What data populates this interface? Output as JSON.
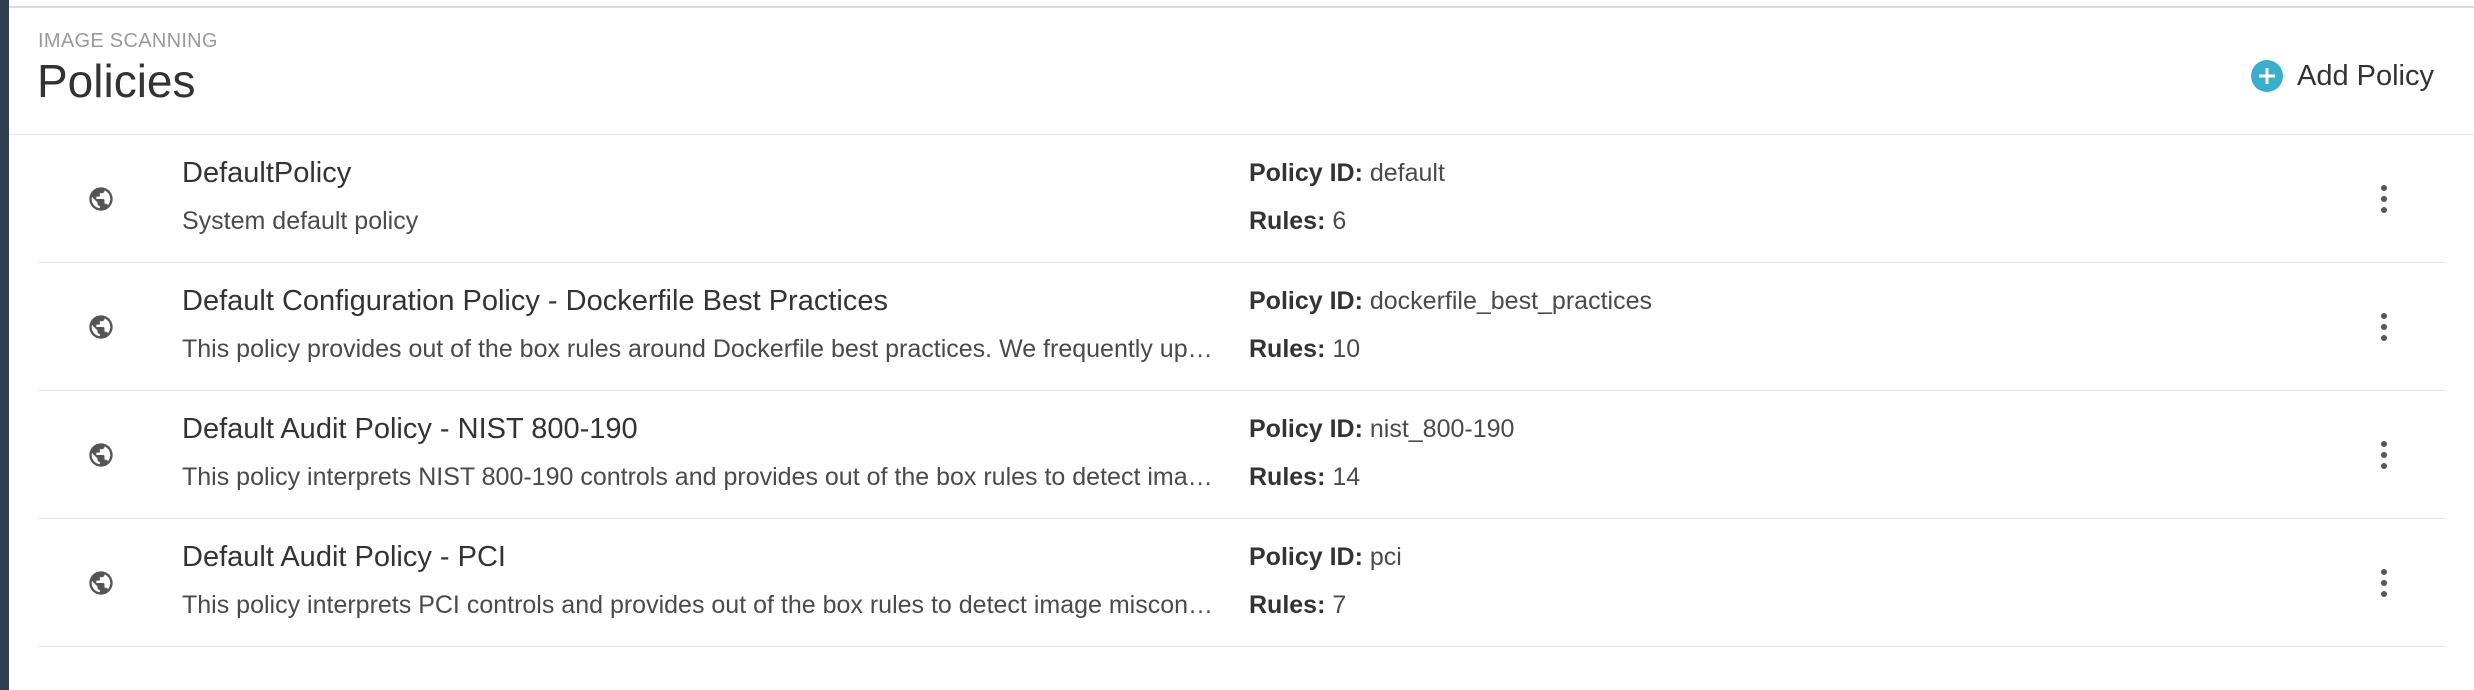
{
  "header": {
    "breadcrumb": "IMAGE SCANNING",
    "title": "Policies",
    "add_label": "Add Policy"
  },
  "policies": [
    {
      "name": "DefaultPolicy",
      "description": "System default policy",
      "id_label": "Policy ID:",
      "id_value": "default",
      "rules_label": "Rules:",
      "rules_value": "6"
    },
    {
      "name": "Default Configuration Policy - Dockerfile Best Practices",
      "description": "This policy provides out of the box rules around Dockerfile best practices. We frequently up…",
      "id_label": "Policy ID:",
      "id_value": "dockerfile_best_practices",
      "rules_label": "Rules:",
      "rules_value": "10"
    },
    {
      "name": "Default Audit Policy - NIST 800-190",
      "description": "This policy interprets NIST 800-190 controls and provides out of the box rules to detect ima…",
      "id_label": "Policy ID:",
      "id_value": "nist_800-190",
      "rules_label": "Rules:",
      "rules_value": "14"
    },
    {
      "name": "Default Audit Policy - PCI",
      "description": "This policy interprets PCI controls and provides out of the box rules to detect image miscon…",
      "id_label": "Policy ID:",
      "id_value": "pci",
      "rules_label": "Rules:",
      "rules_value": "7"
    }
  ],
  "icons": {
    "scope": "globe-icon",
    "add": "plus-circle-icon",
    "menu": "kebab-menu-icon"
  },
  "colors": {
    "accent": "#3aaecb",
    "sidebar": "#2c3e50"
  }
}
